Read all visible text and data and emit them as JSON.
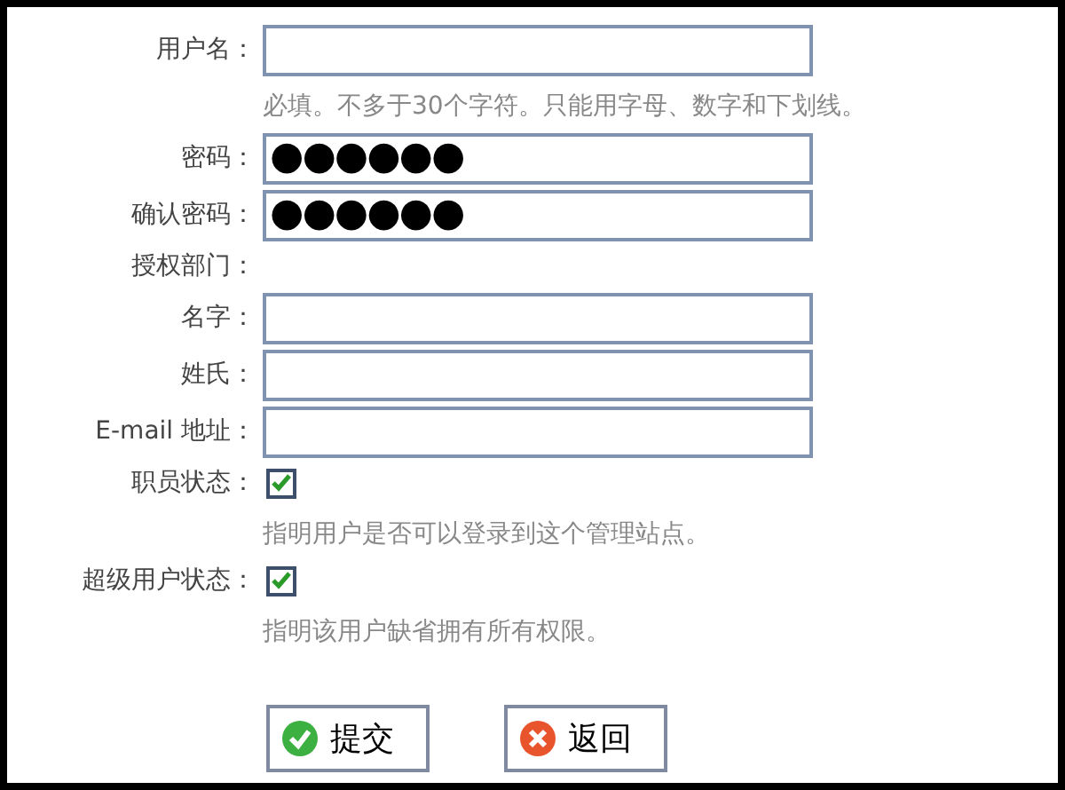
{
  "form": [
    {
      "kind": "text",
      "label": "用户名：",
      "hint": "必填。不多于30个字符。只能用字母、数字和下划线。"
    },
    {
      "kind": "password",
      "label": "密码：",
      "value": "●●●●●●"
    },
    {
      "kind": "password",
      "label": "确认密码：",
      "value": "●●●●●●"
    },
    {
      "kind": "heading",
      "label": "授权部门："
    },
    {
      "kind": "text",
      "label": "名字："
    },
    {
      "kind": "text",
      "label": "姓氏："
    },
    {
      "kind": "text",
      "label": "E-mail 地址："
    },
    {
      "kind": "checkbox",
      "label": "职员状态：",
      "checked": true,
      "hint": "指明用户是否可以登录到这个管理站点。"
    },
    {
      "kind": "checkbox",
      "label": "超级用户状态：",
      "checked": true,
      "hint": "指明该用户缺省拥有所有权限。"
    }
  ],
  "buttons": [
    {
      "kind": "submit",
      "label": "提交"
    },
    {
      "kind": "back",
      "label": "返回"
    }
  ]
}
